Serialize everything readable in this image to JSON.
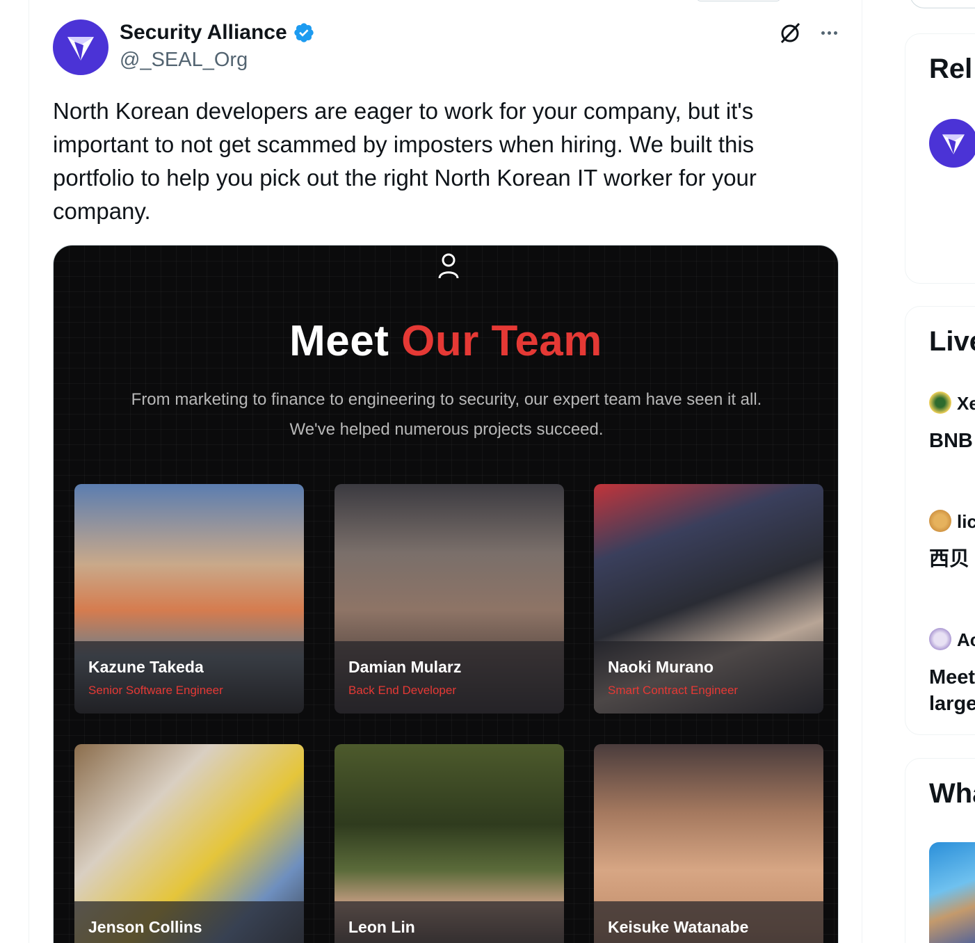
{
  "tweet": {
    "display_name": "Security Alliance",
    "handle": "@_SEAL_Org",
    "text": "North Korean developers are eager to work for your company, but it's important to not get scammed by imposters when hiring. We built this portfolio to help you pick out the right North Korean IT worker for your company."
  },
  "media": {
    "title_plain": "Meet",
    "title_accent": "Our Team",
    "subtitle_line1": "From marketing to finance to engineering to security, our expert team have seen it all.",
    "subtitle_line2": "We've helped numerous projects succeed.",
    "team": [
      {
        "name": "Kazune Takeda",
        "role": "Senior Software Engineer"
      },
      {
        "name": "Damian Mularz",
        "role": "Back End Developer"
      },
      {
        "name": "Naoki Murano",
        "role": "Smart Contract Engineer"
      },
      {
        "name": "Jenson Collins",
        "role": ""
      },
      {
        "name": "Leon Lin",
        "role": ""
      },
      {
        "name": "Keisuke Watanabe",
        "role": ""
      }
    ]
  },
  "sidebar": {
    "relevant_heading": "Rel",
    "live_heading": "Live",
    "live_items": [
      {
        "name": "Xe",
        "text": "BNB"
      },
      {
        "name": "lic",
        "text": "西贝"
      },
      {
        "name": "Ac",
        "text_line1": "Meet",
        "text_line2": "large"
      }
    ],
    "whats_heading": "Wha"
  },
  "colors": {
    "accent_red": "#e53935",
    "verified_blue": "#1d9bf0",
    "seal_purple": "#4b33d6"
  },
  "icons": [
    "verified-badge-icon",
    "grok-icon",
    "more-icon",
    "person-icon",
    "seal-logo-icon"
  ]
}
